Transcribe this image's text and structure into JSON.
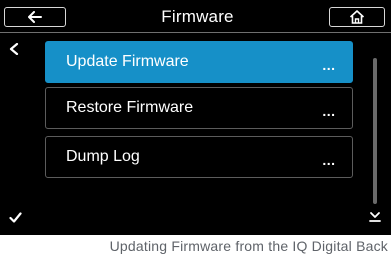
{
  "header": {
    "title": "Firmware",
    "back_icon": "arrow-left-icon",
    "home_icon": "home-icon"
  },
  "menu": {
    "items": [
      {
        "label": "Update Firmware",
        "more": "...",
        "selected": true
      },
      {
        "label": "Restore Firmware",
        "more": "...",
        "selected": false
      },
      {
        "label": "Dump Log",
        "more": "...",
        "selected": false
      }
    ]
  },
  "side_controls": {
    "left_icon": "chevron-left-icon",
    "confirm_icon": "checkmark-icon",
    "scroll_down_icon": "scroll-down-icon"
  },
  "caption": "Updating Firmware from the IQ Digital Back",
  "colors": {
    "screen_background": "#000000",
    "selected_item": "#1690c8",
    "caption_text": "#5f6369"
  }
}
